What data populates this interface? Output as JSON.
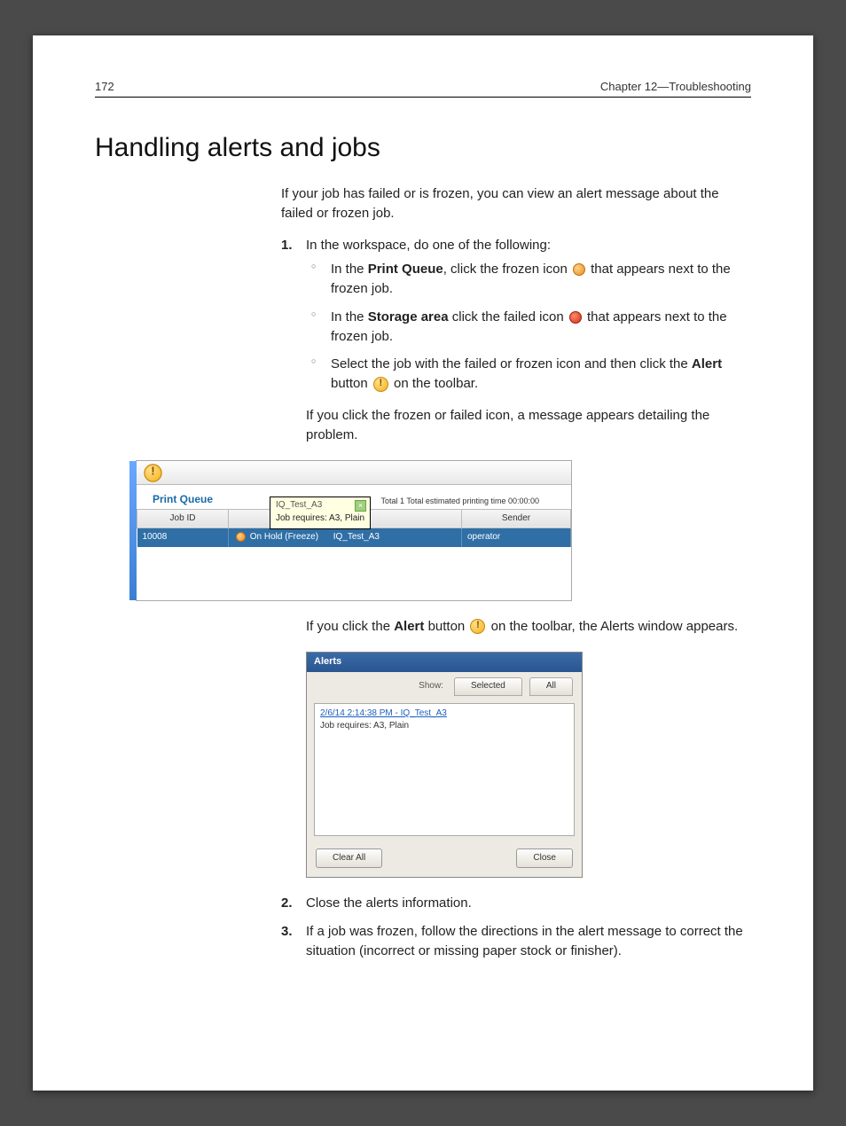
{
  "header": {
    "page_number": "172",
    "chapter_label": "Chapter 12—Troubleshooting"
  },
  "title": "Handling alerts and jobs",
  "intro": "If your job has failed or is frozen, you can view an alert message about the failed or frozen job.",
  "step1_lead": "In the workspace, do one of the following:",
  "bullets": {
    "b1_pre": "In the ",
    "b1_bold": "Print Queue",
    "b1_mid": ", click the frozen icon ",
    "b1_post": " that appears next to the frozen job.",
    "b2_pre": "In the ",
    "b2_bold": "Storage area",
    "b2_mid": " click the failed icon ",
    "b2_post": " that appears next to the frozen job.",
    "b3_pre": "Select the job with the failed or frozen icon and then click the ",
    "b3_bold": "Alert",
    "b3_mid": " button ",
    "b3_post": " on the toolbar."
  },
  "after_bullets": "If you click the frozen or failed icon, a message appears detailing the problem.",
  "queue": {
    "title": "Print Queue",
    "total_line": "Total 1   Total estimated printing time 00:00:00",
    "col_jobid": "Job ID",
    "col_sender": "Sender",
    "row_jobid": "10008",
    "row_status": "On Hold (Freeze)",
    "row_name": "IQ_Test_A3",
    "row_sender": "operator",
    "tooltip_title": "IQ_Test_A3",
    "tooltip_body": "Job requires: A3, Plain"
  },
  "after_queue_pre": "If you click the ",
  "after_queue_bold": "Alert",
  "after_queue_mid": " button ",
  "after_queue_post": " on the toolbar, the Alerts window appears.",
  "alerts_dialog": {
    "title": "Alerts",
    "show_label": "Show:",
    "tab_selected": "Selected",
    "tab_all": "All",
    "line1": "2/6/14 2:14:38 PM - IQ_Test_A3",
    "line2": "Job requires: A3, Plain",
    "btn_clear": "Clear All",
    "btn_close": "Close"
  },
  "step2": "Close the alerts information.",
  "step3": "If a job was frozen, follow the directions in the alert message to correct the situation (incorrect or missing paper stock or finisher).",
  "numbers": {
    "n1": "1.",
    "n2": "2.",
    "n3": "3."
  }
}
